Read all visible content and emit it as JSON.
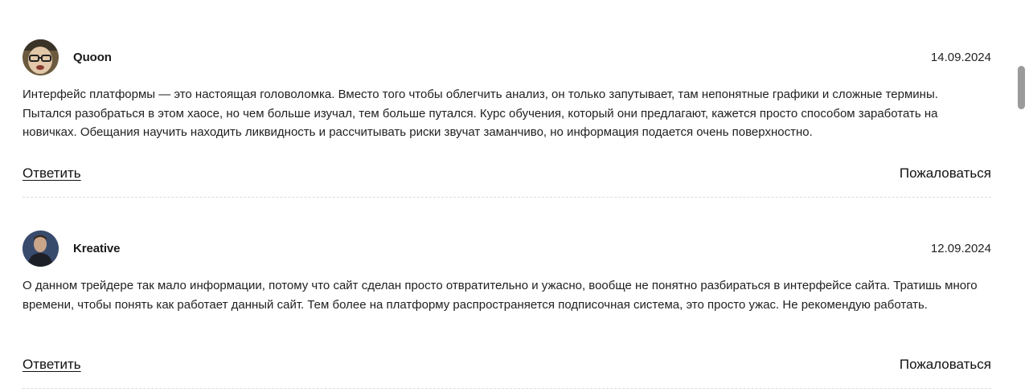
{
  "comments": [
    {
      "author": "Quoon",
      "date": "14.09.2024",
      "text": "Интерфейс платформы — это настоящая головоломка. Вместо того чтобы облегчить анализ, он только запутывает, там непонятные графики и сложные термины. Пытался разобраться в этом хаосе, но чем больше изучал, тем больше путался. Курс обучения, который они предлагают, кажется просто способом заработать на новичках. Обещания научить находить ликвидность и рассчитывать риски звучат заманчиво, но информация подается очень поверхностно.",
      "reply_label": "Ответить",
      "report_label": "Пожаловаться"
    },
    {
      "author": "Kreative",
      "date": "12.09.2024",
      "text": "О данном трейдере так мало информации, потому что сайт сделан просто отвратительно и ужасно, вообще не понятно разбираться в интерфейсе сайта. Тратишь много времени, чтобы понять как работает данный сайт. Тем более на платформу распространяется подписочная система, это просто ужас. Не рекомендую работать.",
      "reply_label": "Ответить",
      "report_label": "Пожаловаться"
    }
  ]
}
